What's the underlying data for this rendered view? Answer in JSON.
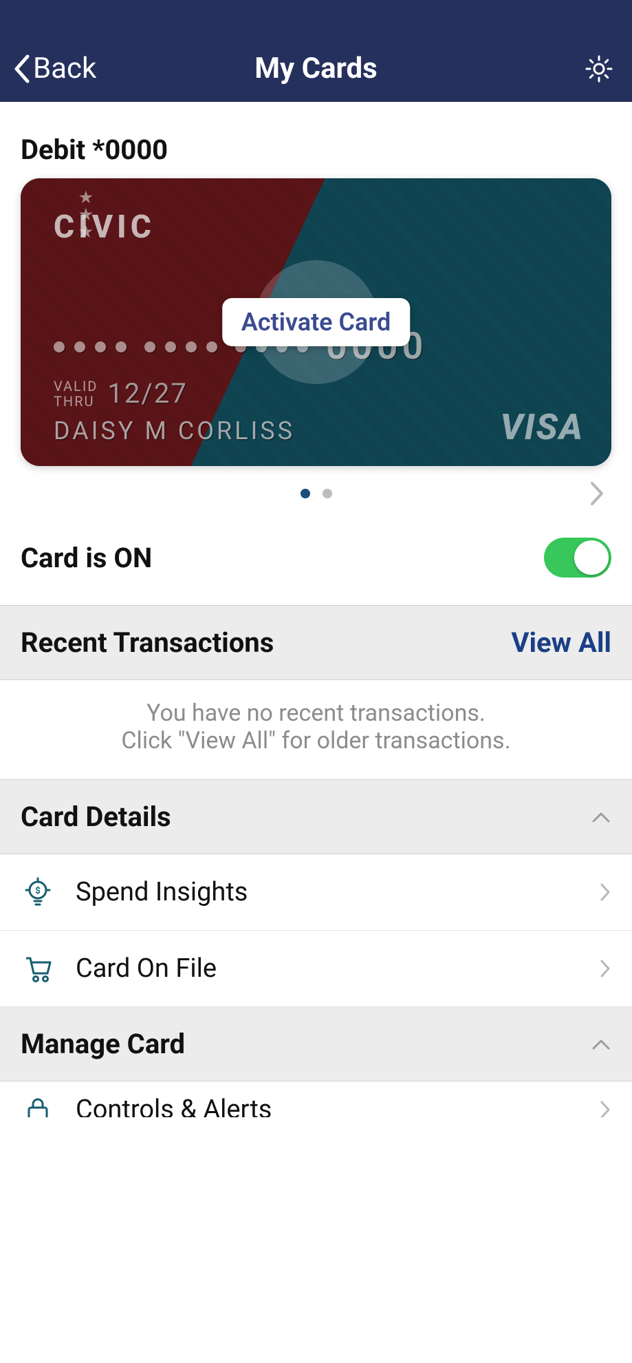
{
  "header": {
    "back": "Back",
    "title": "My Cards"
  },
  "card": {
    "label": "Debit *0000",
    "brand": "CIVIC",
    "last4": "0000",
    "valid_label_1": "VALID",
    "valid_label_2": "THRU",
    "valid_date": "12/27",
    "holder": "DAISY M CORLISS",
    "network": "VISA",
    "activate": "Activate Card"
  },
  "toggle": {
    "label": "Card is ON",
    "state": "on"
  },
  "transactions": {
    "title": "Recent Transactions",
    "view_all": "View All",
    "empty_line1": "You have no recent transactions.",
    "empty_line2": "Click \"View All\" for older transactions."
  },
  "details": {
    "title": "Card Details",
    "rows": {
      "spend": "Spend Insights",
      "cardonfile": "Card On File"
    }
  },
  "manage": {
    "title": "Manage Card",
    "rows": {
      "controls": "Controls & Alerts"
    }
  }
}
